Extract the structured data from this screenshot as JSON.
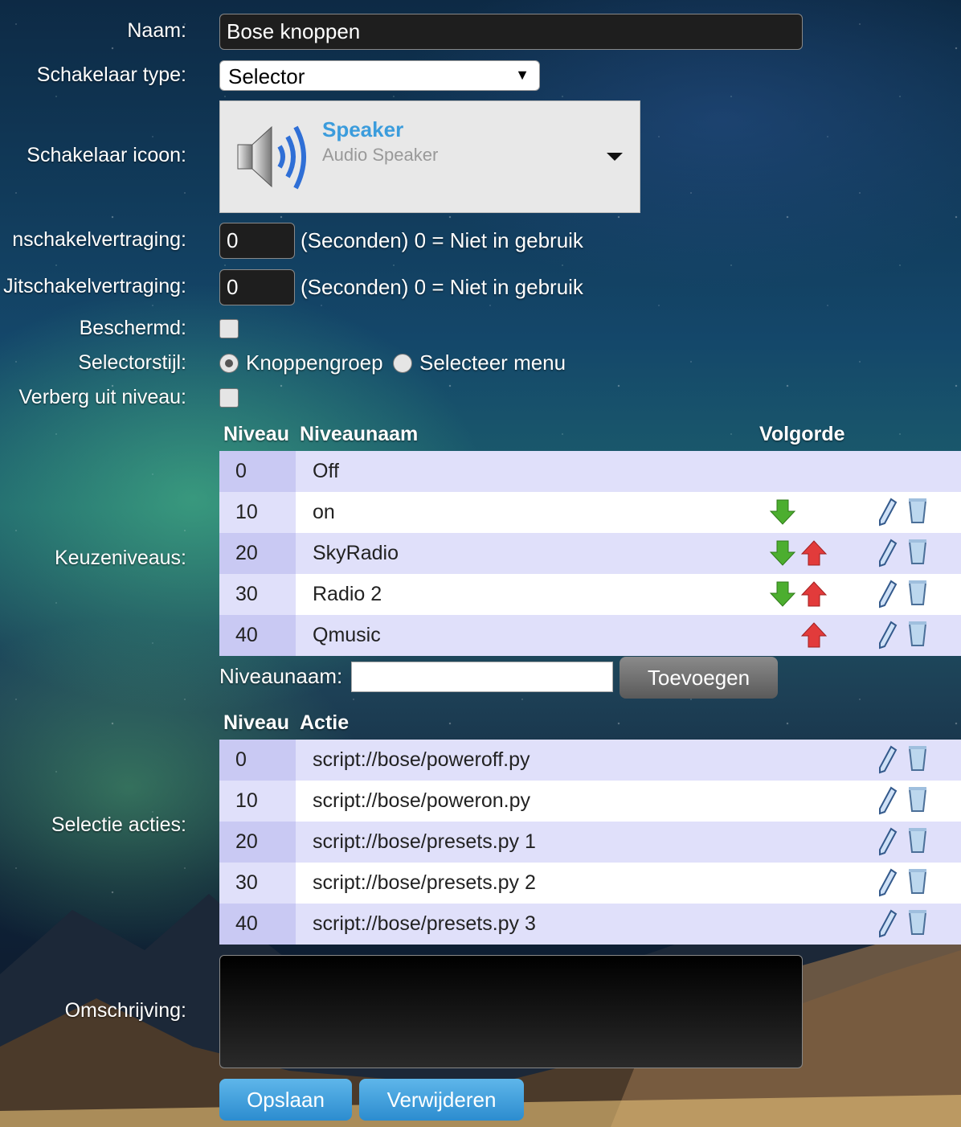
{
  "form": {
    "name_label": "Naam:",
    "name_value": "Bose knoppen",
    "switch_type_label": "Schakelaar type:",
    "switch_type_value": "Selector",
    "switch_icon_label": "Schakelaar icoon:",
    "icon_title": "Speaker",
    "icon_subtitle": "Audio Speaker",
    "on_delay_label": "nschakelvertraging:",
    "on_delay_value": "0",
    "off_delay_label": "Jitschakelvertraging:",
    "off_delay_value": "0",
    "delay_hint": "(Seconden) 0 = Niet in gebruik",
    "protected_label": "Beschermd:",
    "selector_style_label": "Selectorstijl:",
    "style_option_buttons": "Knoppengroep",
    "style_option_menu": "Selecteer menu",
    "hide_off_label": "Verberg uit niveau:",
    "levels_label": "Keuzeniveaus:",
    "actions_label": "Selectie acties:",
    "description_label": "Omschrijving:"
  },
  "levels_table": {
    "header_level": "Niveau",
    "header_name": "Niveaunaam",
    "header_order": "Volgorde",
    "rows": [
      {
        "level": "0",
        "name": "Off",
        "down": false,
        "up": false,
        "editable": false
      },
      {
        "level": "10",
        "name": "on",
        "down": true,
        "up": false,
        "editable": true
      },
      {
        "level": "20",
        "name": "SkyRadio",
        "down": true,
        "up": true,
        "editable": true
      },
      {
        "level": "30",
        "name": "Radio 2",
        "down": true,
        "up": true,
        "editable": true
      },
      {
        "level": "40",
        "name": "Qmusic",
        "down": false,
        "up": true,
        "editable": true
      }
    ]
  },
  "add_level": {
    "label": "Niveaunaam:",
    "button": "Toevoegen"
  },
  "actions_table": {
    "header_level": "Niveau",
    "header_action": "Actie",
    "rows": [
      {
        "level": "0",
        "action": "script://bose/poweroff.py"
      },
      {
        "level": "10",
        "action": "script://bose/poweron.py"
      },
      {
        "level": "20",
        "action": "script://bose/presets.py 1"
      },
      {
        "level": "30",
        "action": "script://bose/presets.py 2"
      },
      {
        "level": "40",
        "action": "script://bose/presets.py 3"
      }
    ]
  },
  "buttons": {
    "save": "Opslaan",
    "delete": "Verwijderen"
  },
  "colors": {
    "accent_blue": "#3b9cdc",
    "arrow_down": "#4cae2f",
    "arrow_up": "#e23b3b"
  }
}
